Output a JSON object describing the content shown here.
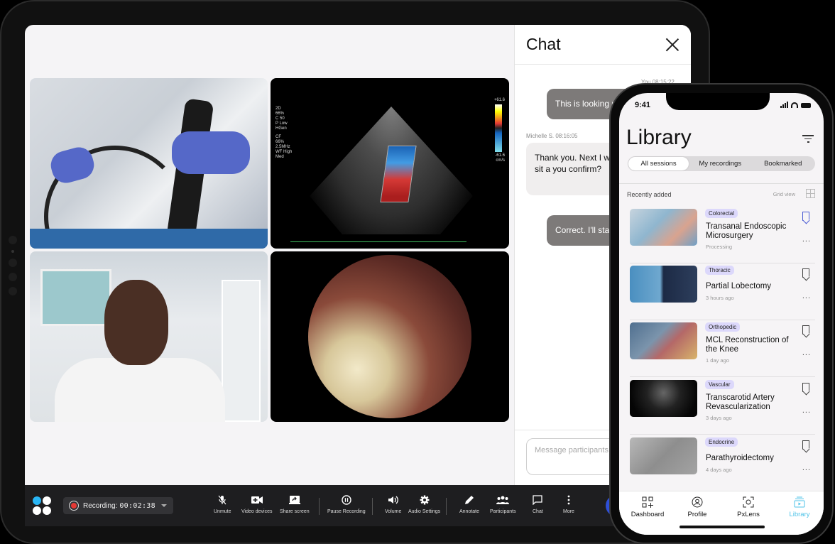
{
  "video_call": {
    "tiles": [
      {
        "name": "endoscopy-procedure-video"
      },
      {
        "name": "echocardiogram-video",
        "overlay_left_1": "2D\n66%\nC 50\nP Low\nHGen",
        "overlay_left_2": "CF\n66%\n2.5MHz\nWF High\nMed",
        "scale_top": "+61.6",
        "scale_bottom": "-61.6",
        "scale_unit": "cm/s"
      },
      {
        "name": "doctor-participant-video"
      },
      {
        "name": "endoscope-view-video"
      }
    ]
  },
  "chat": {
    "title": "Chat",
    "messages": [
      {
        "sender": "You",
        "time": "08:15:22",
        "meta": "You  08:15:22",
        "text": "This is looking r",
        "mine": true
      },
      {
        "sender": "Michelle S.",
        "time": "08:16:05",
        "meta": "Michelle S.  08:16:05",
        "text": "Thank you. Next I wi ipsum the dolor sit a you confirm?",
        "mine": false
      },
      {
        "text": "Correct. I'll sta",
        "mine": true
      }
    ],
    "input_placeholder": "Message participants"
  },
  "toolbar": {
    "recording_label": "Recording:",
    "recording_time": "00:02:38",
    "buttons": [
      {
        "id": "unmute",
        "label": "Unmute",
        "icon": "mic-off-icon"
      },
      {
        "id": "video-devices",
        "label": "Video devices",
        "icon": "video-plus-icon"
      },
      {
        "id": "share-screen",
        "label": "Share screen",
        "icon": "share-screen-icon"
      },
      {
        "id": "pause-recording",
        "label": "Pause Recording",
        "icon": "pause-circle-icon"
      },
      {
        "id": "volume",
        "label": "Volume",
        "icon": "volume-icon"
      },
      {
        "id": "audio-settings",
        "label": "Audio Settings",
        "icon": "gear-icon"
      },
      {
        "id": "annotate",
        "label": "Annotate",
        "icon": "pencil-icon"
      },
      {
        "id": "participants",
        "label": "Participants",
        "icon": "participants-icon"
      },
      {
        "id": "chat",
        "label": "Chat",
        "icon": "chat-icon"
      },
      {
        "id": "more",
        "label": "More",
        "icon": "more-vertical-icon"
      }
    ],
    "colors": {
      "record": "#e53935",
      "logo_accent": "#29b6f6"
    }
  },
  "phone": {
    "status_time": "9:41",
    "title": "Library",
    "segments": [
      {
        "label": "All sessions",
        "active": true
      },
      {
        "label": "My recordings",
        "active": false
      },
      {
        "label": "Bookmarked",
        "active": false
      }
    ],
    "section_label": "Recently added",
    "grid_view_label": "Grid view",
    "items": [
      {
        "tag": "Colorectal",
        "title": "Transanal Endoscopic Microsurgery",
        "subtitle": "Processing",
        "bookmarked": true
      },
      {
        "tag": "Thoracic",
        "title": "Partial Lobectomy",
        "subtitle": "3 hours ago",
        "bookmarked": false
      },
      {
        "tag": "Orthopedic",
        "title": "MCL Reconstruction of the Knee",
        "subtitle": "1 day ago",
        "bookmarked": false
      },
      {
        "tag": "Vascular",
        "title": "Transcarotid Artery Revascularization",
        "subtitle": "3 days ago",
        "bookmarked": false
      },
      {
        "tag": "Endocrine",
        "title": "Parathyroidectomy",
        "subtitle": "4 days ago",
        "bookmarked": false
      }
    ],
    "more_label": "...",
    "tabs": [
      {
        "label": "Dashboard",
        "icon": "dashboard-icon",
        "active": false
      },
      {
        "label": "Profile",
        "icon": "profile-icon",
        "active": false
      },
      {
        "label": "PxLens",
        "icon": "scan-icon",
        "active": false
      },
      {
        "label": "Library",
        "icon": "library-icon",
        "active": true
      }
    ],
    "colors": {
      "tag_bg": "#dcd8fb",
      "active_tab": "#4fc3e8",
      "bookmark_saved": "#4a5bd4"
    }
  }
}
